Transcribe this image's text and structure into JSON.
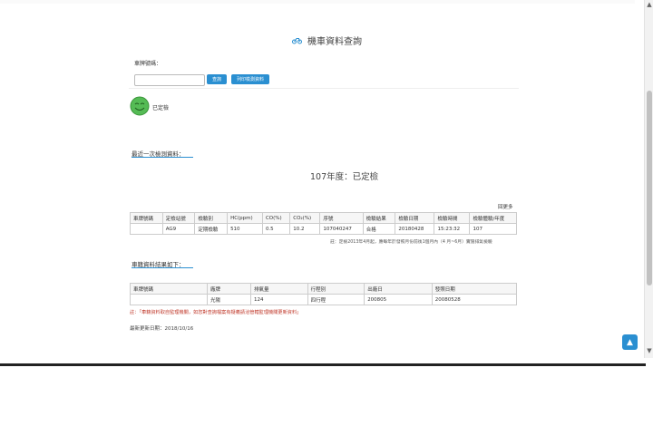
{
  "header": {
    "title": "機車資料查詢",
    "icon": "motorcycle-icon"
  },
  "search": {
    "plate_label": "車牌號碼：",
    "plate_value": "",
    "query_label": "查詢",
    "print_label": "列印檢測資料"
  },
  "status": {
    "icon": "smiley-icon",
    "text": "已定檢"
  },
  "latest": {
    "section_title": "最近一次檢測資料：",
    "year_status": "107年度：已定檢",
    "more_label": "回更多",
    "headers": [
      "車牌號碼",
      "定檢站號",
      "檢驗別",
      "HC(ppm)",
      "CO(%)",
      "CO₂(%)",
      "序號",
      "檢驗結果",
      "檢驗日期",
      "檢驗時間",
      "檢驗體驗/年度"
    ],
    "row": [
      "",
      "AG9",
      "定期檢驗",
      "510",
      "0.5",
      "10.2",
      "107040247",
      "合格",
      "20180428",
      "15:23:32",
      "107"
    ],
    "note": "註：定檢2013年4月起，應每年於發照月份前後1個月內（4 月~6月）實施排氣檢驗"
  },
  "vehicle": {
    "section_title": "車籍資料結果如下：",
    "headers": [
      "車牌號碼",
      "廠牌",
      "排氣量",
      "行程別",
      "出廠日",
      "發照日期"
    ],
    "row": [
      "",
      "光陽",
      "124",
      "四行程",
      "200805",
      "20080528"
    ],
    "warning": "註：「車籍資料取自監理機關，如您對查詢檔案有疑義請洽管轄監理機關更新資料」",
    "updated": "最新更新日期：2018/10/16"
  },
  "to_top_icon": "arrow-up-icon"
}
